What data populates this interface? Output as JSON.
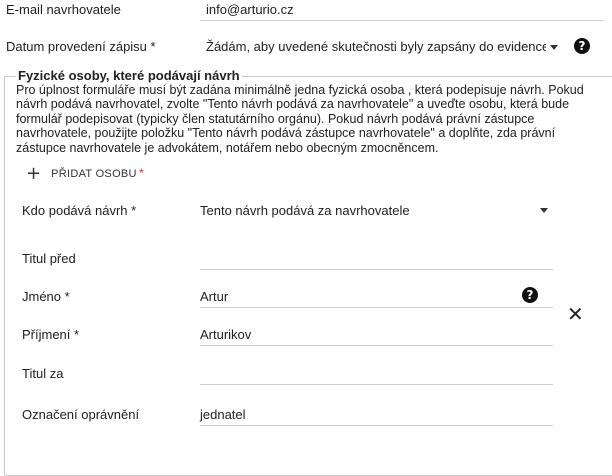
{
  "email": {
    "label": "E-mail navrhovatele",
    "value": "info@arturio.cz"
  },
  "datum": {
    "label": "Datum provedení zápisu *",
    "value": "Žádám, aby uvedené skutečnosti byly zapsány do evidence s",
    "help_icon": "help-circle-icon"
  },
  "section": {
    "title": "Fyzické osoby, které podávají návrh",
    "description": "Pro úplnost formuláře musí být zadána minimálně jedna fyzická osoba , která podepisuje návrh. Pokud návrh  podává navrhovatel, zvolte \"Tento návrh podává za navrhovatele\" a  uveďte osobu, která bude formulář podepisovat (typicky člen statutárního orgánu). Pokud návrh podává právní zástupce navrhovatele, použijte položku \"Tento návrh podává zástupce navrhovatele\" a doplňte, zda právní zástupce navrhovatele je advokátem, notářem nebo obecným zmocněncem.",
    "add_button": {
      "icon": "plus-icon",
      "label": "PŘIDAT OSOBU",
      "required_mark": "*"
    }
  },
  "person": {
    "kdo": {
      "label": "Kdo podává návrh *",
      "value": "Tento návrh podává za navrhovatele"
    },
    "titul_pred": {
      "label": "Titul před",
      "value": ""
    },
    "jmeno": {
      "label": "Jméno *",
      "value": "Artur",
      "help_icon": "help-circle-icon"
    },
    "prijmeni": {
      "label": "Příjmení *",
      "value": "Arturikov"
    },
    "titul_za": {
      "label": "Titul za",
      "value": ""
    },
    "opravneni": {
      "label": "Označení oprávnění",
      "value": "jednatel"
    },
    "remove_icon": "close-icon"
  }
}
